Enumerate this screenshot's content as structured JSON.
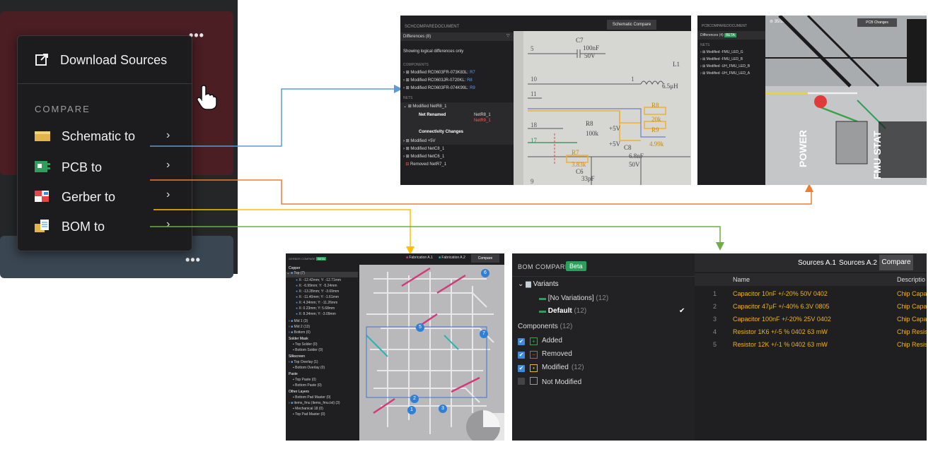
{
  "menu": {
    "download_label": "Download Sources",
    "compare_heading": "COMPARE",
    "items": [
      {
        "label": "Schematic to",
        "icon": "schematic-icon"
      },
      {
        "label": "PCB to",
        "icon": "pcb-icon"
      },
      {
        "label": "Gerber to",
        "icon": "gerber-icon"
      },
      {
        "label": "BOM to",
        "icon": "bom-icon"
      }
    ],
    "more_dots": "•••",
    "chevron": "›"
  },
  "colors": {
    "schematic_arrow": "#5b9bd5",
    "pcb_arrow": "#ed7d31",
    "gerber_arrow": "#ffc000",
    "bom_arrow": "#70ad47"
  },
  "sch": {
    "doc_title": "SCHCOMPAREDOCUMENT",
    "tab": "Schematic Compare",
    "differences": "Differences (8)",
    "filter_note": "Showing logical differences only",
    "components_heading": "COMPONENTS",
    "components": [
      {
        "text": "Modified RC0603FR-073K83L:",
        "ref": "R7"
      },
      {
        "text": "Modified RC0603JR-0720KL:",
        "ref": "R8"
      },
      {
        "text": "Modified RC0603FR-074K99L:",
        "ref": "R9"
      }
    ],
    "nets_heading": "NETS",
    "net_expanded": "Modified NetR8_1",
    "net_renamed_label": "Net Renamed",
    "net_renamed_old": "NetR8_1",
    "net_renamed_new": "NetR9_1",
    "connectivity": "Connectivity Changes",
    "nets": [
      "Modified +5V",
      "Modified NetC8_1",
      "Modified NetC6_1",
      "Removed NetR7_1"
    ],
    "canvas_labels": {
      "c7": "C7",
      "c7v": "100nF",
      "c7w": "50V",
      "l1": "L1",
      "l1v": "6.5μH",
      "r8": "R8",
      "r8v": "100k",
      "r8b": "R8",
      "r8bv": "20k",
      "r9": "R9",
      "r9v": "4.99k",
      "p5": "+5V",
      "p5b": "+5V",
      "c8": "C8",
      "c8v": "6.8nF",
      "c8w": "50V",
      "r7": "R7",
      "r7v": "3.83k",
      "c6": "C6",
      "c6v": "33pF",
      "c6w": "50V",
      "n5": "5",
      "n10": "10",
      "n11": "11",
      "n18": "18",
      "n17": "17",
      "n9": "9",
      "n1": "1"
    }
  },
  "pcb": {
    "doc_title": "PCBCOMPAREDOCUMENT",
    "differences": "Differences (4)",
    "beta": "BETA",
    "counter": "35/38",
    "tab": "PCB Changes",
    "nets_heading": "NETS",
    "nets": [
      "Modified -FMU_LED_G",
      "Modified -FMU_LED_B",
      "Modified -UH_FMU_LED_B",
      "Modified -UH_FMU_LED_A"
    ],
    "silk": [
      "POWER",
      "FMU STAT"
    ]
  },
  "gerber": {
    "title": "GERBER COMPARE",
    "beta": "BETA",
    "tabs": [
      "Fabrication A.1",
      "Fabrication A.2",
      "Compare"
    ],
    "copper": "Copper",
    "top_layer": "Top (7)",
    "coords": [
      "X: -12.42mm; Y: -12.71mm",
      "X: -6.99mm; Y: -5.24mm",
      "X: -13.28mm; Y: -3.69mm",
      "X: -11.40mm; Y: -1.61mm",
      "X: 4.34mm; Y: -11.26mm",
      "X: 0.23mm; Y: 5.68mm",
      "X: 8.34mm; Y: -3.09mm"
    ],
    "layers": [
      "Mid 1 (3)",
      "Mid 2 (13)",
      "Bottom (0)"
    ],
    "solder_mask": "Solder Mask",
    "solder_items": [
      "Top Solder (0)",
      "Bottom Solder (0)"
    ],
    "silkscreen": "Silkscreen",
    "silk_items": [
      "Top Overlay (1)",
      "Bottom Overlay (0)"
    ],
    "paste": "Paste",
    "paste_items": [
      "Top Paste (0)",
      "Bottom Paste (0)"
    ],
    "other": "Other Layers",
    "other_items": [
      "Bottom Pad Master (0)",
      "items_fmu (items_fmu.txt) (3)",
      "Mechanical 18 (0)",
      "Top Pad Master (0)"
    ],
    "markers": [
      "6",
      "5",
      "7",
      "2",
      "1",
      "3"
    ]
  },
  "bom": {
    "title": "BOM COMPARE",
    "beta": "Beta",
    "tabs": [
      "Sources A.1",
      "Sources A.2",
      "Compare"
    ],
    "variants": "Variants",
    "variant_items": [
      {
        "name": "[No Variations]",
        "count": "(12)"
      },
      {
        "name": "Default",
        "count": "(12)"
      }
    ],
    "components_label": "Components",
    "components_count": "(12)",
    "filters": [
      {
        "label": "Added",
        "count": "",
        "checked": true
      },
      {
        "label": "Removed",
        "count": "",
        "checked": true
      },
      {
        "label": "Modified",
        "count": "(12)",
        "checked": true
      },
      {
        "label": "Not Modified",
        "count": "",
        "checked": false
      }
    ],
    "columns": [
      "Name",
      "Descriptio"
    ],
    "rows": [
      {
        "n": "1",
        "name": "Capacitor 10nF +/-20% 50V 0402",
        "desc": "Chip Capa"
      },
      {
        "n": "2",
        "name": "Capacitor 47μF +/-40% 6.3V 0805",
        "desc": "Chip Capa"
      },
      {
        "n": "3",
        "name": "Capacitor 100nF +/-20% 25V 0402",
        "desc": "Chip Capa"
      },
      {
        "n": "4",
        "name": "Resistor 1K6 +/-5 % 0402 63 mW",
        "desc": "Chip Resis"
      },
      {
        "n": "5",
        "name": "Resistor 12K +/-1 % 0402 63 mW",
        "desc": "Chip Resis"
      }
    ],
    "check": "✔"
  }
}
